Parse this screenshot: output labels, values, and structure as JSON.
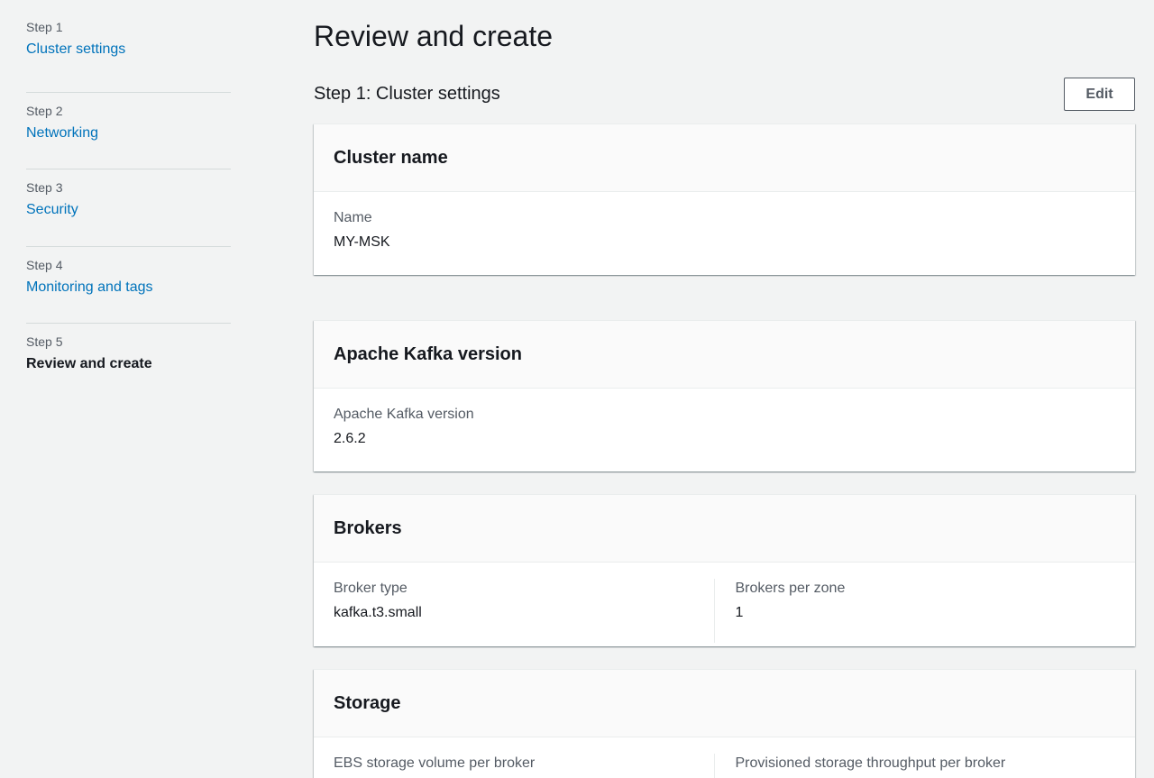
{
  "nav": {
    "steps": [
      {
        "num": "Step 1",
        "label": "Cluster settings"
      },
      {
        "num": "Step 2",
        "label": "Networking"
      },
      {
        "num": "Step 3",
        "label": "Security"
      },
      {
        "num": "Step 4",
        "label": "Monitoring and tags"
      },
      {
        "num": "Step 5",
        "label": "Review and create"
      }
    ]
  },
  "main": {
    "title": "Review and create",
    "section_title": "Step 1: Cluster settings",
    "edit_label": "Edit",
    "cards": [
      {
        "title": "Cluster name",
        "fields": [
          {
            "label": "Name",
            "value": "MY-MSK"
          }
        ]
      },
      {
        "title": "Apache Kafka version",
        "fields": [
          {
            "label": "Apache Kafka version",
            "value": "2.6.2"
          }
        ]
      },
      {
        "title": "Brokers",
        "fields": [
          {
            "label": "Broker type",
            "value": "kafka.t3.small"
          },
          {
            "label": "Brokers per zone",
            "value": "1"
          }
        ]
      },
      {
        "title": "Storage",
        "fields": [
          {
            "label": "EBS storage volume per broker",
            "value": ""
          },
          {
            "label": "Provisioned storage throughput per broker",
            "value": ""
          }
        ]
      }
    ]
  },
  "colors": {
    "link": "#0073bb",
    "background": "#f2f3f3",
    "text": "#16191f",
    "secondary_text": "#545b64"
  }
}
